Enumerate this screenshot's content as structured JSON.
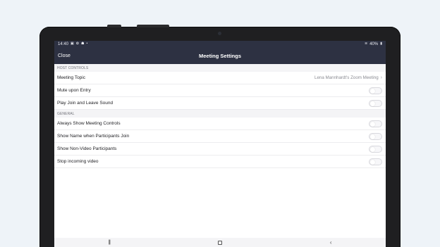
{
  "status_bar": {
    "time": "14:40",
    "left_icons": [
      "image-icon",
      "settings-icon",
      "bug-icon"
    ],
    "right_text": "40%"
  },
  "nav": {
    "close_label": "Close",
    "title": "Meeting Settings"
  },
  "sections": {
    "host_controls": {
      "header": "HOST CONTROLS",
      "meeting_topic": {
        "label": "Meeting Topic",
        "value": "Lena Mannhardt's Zoom Meeting"
      },
      "mute_upon_entry": {
        "label": "Mute upon Entry",
        "enabled": false
      },
      "play_join_leave_sound": {
        "label": "Play Join and Leave Sound",
        "enabled": false
      }
    },
    "general": {
      "header": "GENERAL",
      "always_show_controls": {
        "label": "Always Show Meeting Controls",
        "enabled": false
      },
      "show_name_on_join": {
        "label": "Show Name when Participants Join",
        "enabled": false
      },
      "show_non_video": {
        "label": "Show Non-Video Participants",
        "enabled": false
      },
      "stop_incoming_video": {
        "label": "Stop incoming video",
        "enabled": false
      }
    }
  },
  "colors": {
    "header_bg": "#2d3142",
    "page_bg": "#eef3f8",
    "device_bezel": "#1f1f21"
  }
}
